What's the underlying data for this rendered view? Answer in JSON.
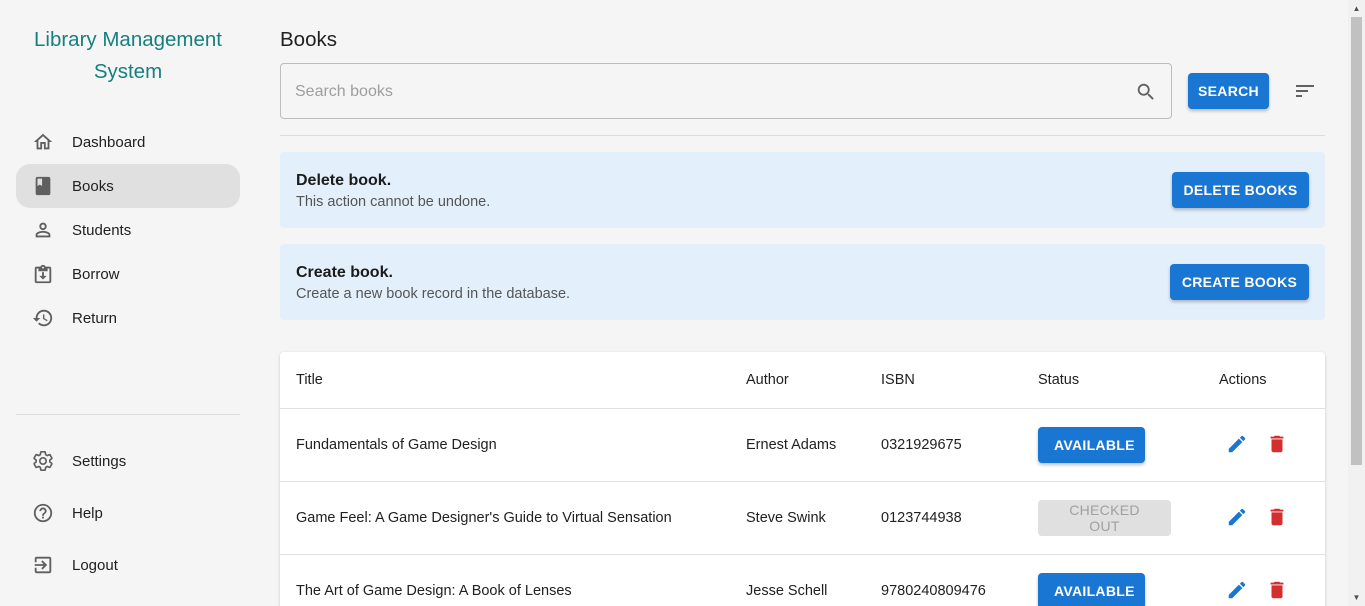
{
  "brand": {
    "line1": "Library Management",
    "line2": "System",
    "color": "#17807f"
  },
  "nav": {
    "items": [
      {
        "label": "Dashboard",
        "icon": "home-icon"
      },
      {
        "label": "Books",
        "icon": "book-icon",
        "active": true
      },
      {
        "label": "Students",
        "icon": "person-icon"
      },
      {
        "label": "Borrow",
        "icon": "borrow-icon"
      },
      {
        "label": "Return",
        "icon": "history-icon"
      }
    ],
    "bottom": [
      {
        "label": "Settings",
        "icon": "gear-icon"
      },
      {
        "label": "Help",
        "icon": "help-icon"
      },
      {
        "label": "Logout",
        "icon": "logout-icon"
      }
    ]
  },
  "page": {
    "title": "Books"
  },
  "search": {
    "placeholder": "Search books",
    "value": "",
    "button": "Search"
  },
  "alerts": [
    {
      "title": "Delete book.",
      "description": "This action cannot be undone.",
      "button": "Delete Books"
    },
    {
      "title": "Create book.",
      "description": "Create a new book record in the database.",
      "button": "Create Books"
    }
  ],
  "table": {
    "columns": [
      "Title",
      "Author",
      "ISBN",
      "Status",
      "Actions"
    ],
    "rows": [
      {
        "title": "Fundamentals of Game Design",
        "author": "Ernest Adams",
        "isbn": "0321929675",
        "status": "AVAILABLE"
      },
      {
        "title": "Game Feel: A Game Designer's Guide to Virtual Sensation",
        "author": "Steve Swink",
        "isbn": "0123744938",
        "status": "CHECKED OUT"
      },
      {
        "title": "The Art of Game Design: A Book of Lenses",
        "author": "Jesse Schell",
        "isbn": "9780240809476",
        "status": "AVAILABLE"
      }
    ]
  },
  "colors": {
    "primary": "#1976d2",
    "danger": "#d32f2f",
    "alert_bg": "#e3f0fc",
    "active_nav": "#e0e0e0"
  }
}
